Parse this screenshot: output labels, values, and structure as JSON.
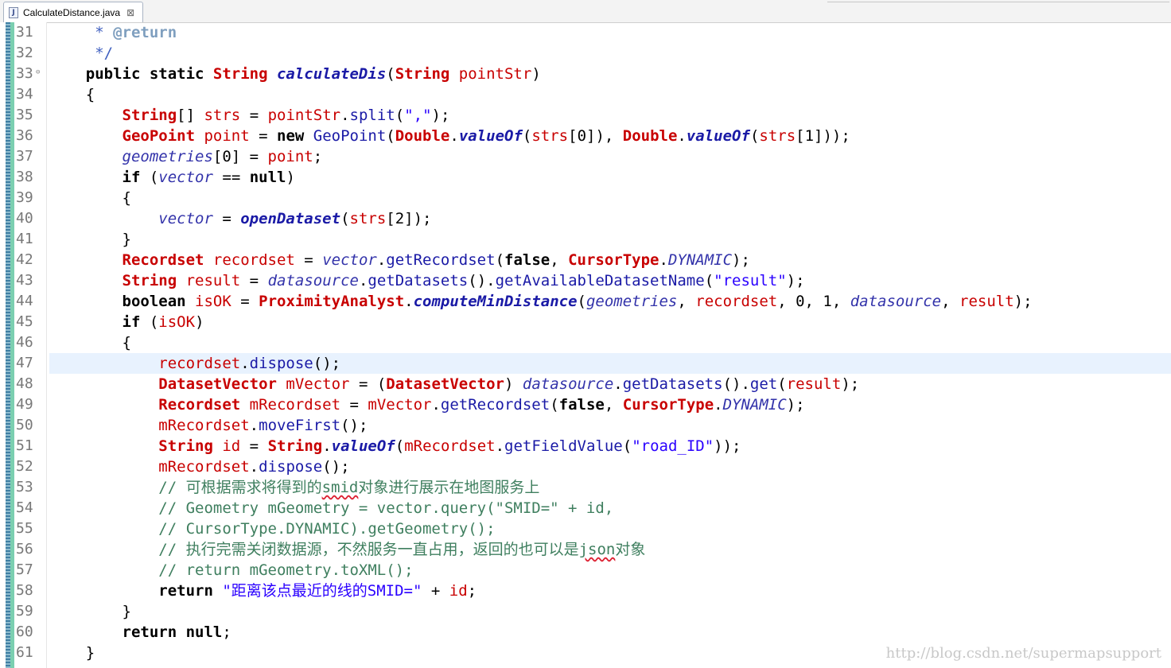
{
  "tab": {
    "title": "CalculateDistance.java",
    "icon": "java-file-icon",
    "close_glyph": "⊠"
  },
  "watermark": "http://blog.csdn.net/supermapsupport",
  "line_numbers": [
    "31",
    "32",
    "33",
    "34",
    "35",
    "36",
    "37",
    "38",
    "39",
    "40",
    "41",
    "42",
    "43",
    "44",
    "45",
    "46",
    "47",
    "48",
    "49",
    "50",
    "51",
    "52",
    "53",
    "54",
    "55",
    "56",
    "57",
    "58",
    "59",
    "60",
    "61"
  ],
  "highlighted_line": "47",
  "code": [
    [
      {
        "c": "cd",
        "t": "     * "
      },
      {
        "c": "tag",
        "t": "@return"
      }
    ],
    [
      {
        "c": "cd",
        "t": "     */"
      }
    ],
    [
      {
        "c": "k",
        "t": "    public static "
      },
      {
        "c": "t",
        "t": "String "
      },
      {
        "c": "sm",
        "t": "calculateDis"
      },
      {
        "c": "p",
        "t": "("
      },
      {
        "c": "t",
        "t": "String "
      },
      {
        "c": "v",
        "t": "pointStr"
      },
      {
        "c": "p",
        "t": ")"
      }
    ],
    [
      {
        "c": "p",
        "t": "    {"
      }
    ],
    [
      {
        "c": "t",
        "t": "        String"
      },
      {
        "c": "p",
        "t": "[] "
      },
      {
        "c": "v",
        "t": "strs"
      },
      {
        "c": "p",
        "t": " = "
      },
      {
        "c": "v",
        "t": "pointStr"
      },
      {
        "c": "p",
        "t": "."
      },
      {
        "c": "m",
        "t": "split"
      },
      {
        "c": "p",
        "t": "("
      },
      {
        "c": "s",
        "t": "\",\""
      },
      {
        "c": "p",
        "t": ");"
      }
    ],
    [
      {
        "c": "t",
        "t": "        GeoPoint "
      },
      {
        "c": "v",
        "t": "point"
      },
      {
        "c": "p",
        "t": " = "
      },
      {
        "c": "k",
        "t": "new "
      },
      {
        "c": "m",
        "t": "GeoPoint"
      },
      {
        "c": "p",
        "t": "("
      },
      {
        "c": "t",
        "t": "Double"
      },
      {
        "c": "p",
        "t": "."
      },
      {
        "c": "sm",
        "t": "valueOf"
      },
      {
        "c": "p",
        "t": "("
      },
      {
        "c": "v",
        "t": "strs"
      },
      {
        "c": "p",
        "t": "[0]), "
      },
      {
        "c": "t",
        "t": "Double"
      },
      {
        "c": "p",
        "t": "."
      },
      {
        "c": "sm",
        "t": "valueOf"
      },
      {
        "c": "p",
        "t": "("
      },
      {
        "c": "v",
        "t": "strs"
      },
      {
        "c": "p",
        "t": "[1]));"
      }
    ],
    [
      {
        "c": "e",
        "t": "        geometries"
      },
      {
        "c": "p",
        "t": "[0] = "
      },
      {
        "c": "v",
        "t": "point"
      },
      {
        "c": "p",
        "t": ";"
      }
    ],
    [
      {
        "c": "k",
        "t": "        if "
      },
      {
        "c": "p",
        "t": "("
      },
      {
        "c": "e",
        "t": "vector"
      },
      {
        "c": "p",
        "t": " == "
      },
      {
        "c": "k",
        "t": "null"
      },
      {
        "c": "p",
        "t": ")"
      }
    ],
    [
      {
        "c": "p",
        "t": "        {"
      }
    ],
    [
      {
        "c": "e",
        "t": "            vector"
      },
      {
        "c": "p",
        "t": " = "
      },
      {
        "c": "sm",
        "t": "openDataset"
      },
      {
        "c": "p",
        "t": "("
      },
      {
        "c": "v",
        "t": "strs"
      },
      {
        "c": "p",
        "t": "[2]);"
      }
    ],
    [
      {
        "c": "p",
        "t": "        }"
      }
    ],
    [
      {
        "c": "t",
        "t": "        Recordset "
      },
      {
        "c": "v",
        "t": "recordset"
      },
      {
        "c": "p",
        "t": " = "
      },
      {
        "c": "e",
        "t": "vector"
      },
      {
        "c": "p",
        "t": "."
      },
      {
        "c": "m",
        "t": "getRecordset"
      },
      {
        "c": "p",
        "t": "("
      },
      {
        "c": "k",
        "t": "false"
      },
      {
        "c": "p",
        "t": ", "
      },
      {
        "c": "t",
        "t": "CursorType"
      },
      {
        "c": "p",
        "t": "."
      },
      {
        "c": "e",
        "t": "DYNAMIC"
      },
      {
        "c": "p",
        "t": ");"
      }
    ],
    [
      {
        "c": "t",
        "t": "        String "
      },
      {
        "c": "v",
        "t": "result"
      },
      {
        "c": "p",
        "t": " = "
      },
      {
        "c": "e",
        "t": "datasource"
      },
      {
        "c": "p",
        "t": "."
      },
      {
        "c": "m",
        "t": "getDatasets"
      },
      {
        "c": "p",
        "t": "()."
      },
      {
        "c": "m",
        "t": "getAvailableDatasetName"
      },
      {
        "c": "p",
        "t": "("
      },
      {
        "c": "s",
        "t": "\"result\""
      },
      {
        "c": "p",
        "t": ");"
      }
    ],
    [
      {
        "c": "k",
        "t": "        boolean "
      },
      {
        "c": "v",
        "t": "isOK"
      },
      {
        "c": "p",
        "t": " = "
      },
      {
        "c": "t",
        "t": "ProximityAnalyst"
      },
      {
        "c": "p",
        "t": "."
      },
      {
        "c": "sm",
        "t": "computeMinDistance"
      },
      {
        "c": "p",
        "t": "("
      },
      {
        "c": "e",
        "t": "geometries"
      },
      {
        "c": "p",
        "t": ", "
      },
      {
        "c": "v",
        "t": "recordset"
      },
      {
        "c": "p",
        "t": ", 0, 1, "
      },
      {
        "c": "e",
        "t": "datasource"
      },
      {
        "c": "p",
        "t": ", "
      },
      {
        "c": "v",
        "t": "result"
      },
      {
        "c": "p",
        "t": ");"
      }
    ],
    [
      {
        "c": "k",
        "t": "        if "
      },
      {
        "c": "p",
        "t": "("
      },
      {
        "c": "v",
        "t": "isOK"
      },
      {
        "c": "p",
        "t": ")"
      }
    ],
    [
      {
        "c": "p",
        "t": "        {"
      }
    ],
    [
      {
        "c": "v",
        "t": "            recordset"
      },
      {
        "c": "p",
        "t": "."
      },
      {
        "c": "m",
        "t": "dispose"
      },
      {
        "c": "p",
        "t": "();"
      }
    ],
    [
      {
        "c": "t",
        "t": "            DatasetVector "
      },
      {
        "c": "v",
        "t": "mVector"
      },
      {
        "c": "p",
        "t": " = ("
      },
      {
        "c": "t",
        "t": "DatasetVector"
      },
      {
        "c": "p",
        "t": ") "
      },
      {
        "c": "e",
        "t": "datasource"
      },
      {
        "c": "p",
        "t": "."
      },
      {
        "c": "m",
        "t": "getDatasets"
      },
      {
        "c": "p",
        "t": "()."
      },
      {
        "c": "m",
        "t": "get"
      },
      {
        "c": "p",
        "t": "("
      },
      {
        "c": "v",
        "t": "result"
      },
      {
        "c": "p",
        "t": ");"
      }
    ],
    [
      {
        "c": "t",
        "t": "            Recordset "
      },
      {
        "c": "v",
        "t": "mRecordset"
      },
      {
        "c": "p",
        "t": " = "
      },
      {
        "c": "v",
        "t": "mVector"
      },
      {
        "c": "p",
        "t": "."
      },
      {
        "c": "m",
        "t": "getRecordset"
      },
      {
        "c": "p",
        "t": "("
      },
      {
        "c": "k",
        "t": "false"
      },
      {
        "c": "p",
        "t": ", "
      },
      {
        "c": "t",
        "t": "CursorType"
      },
      {
        "c": "p",
        "t": "."
      },
      {
        "c": "e",
        "t": "DYNAMIC"
      },
      {
        "c": "p",
        "t": ");"
      }
    ],
    [
      {
        "c": "v",
        "t": "            mRecordset"
      },
      {
        "c": "p",
        "t": "."
      },
      {
        "c": "m",
        "t": "moveFirst"
      },
      {
        "c": "p",
        "t": "();"
      }
    ],
    [
      {
        "c": "t",
        "t": "            String "
      },
      {
        "c": "v",
        "t": "id"
      },
      {
        "c": "p",
        "t": " = "
      },
      {
        "c": "t",
        "t": "String"
      },
      {
        "c": "p",
        "t": "."
      },
      {
        "c": "sm",
        "t": "valueOf"
      },
      {
        "c": "p",
        "t": "("
      },
      {
        "c": "v",
        "t": "mRecordset"
      },
      {
        "c": "p",
        "t": "."
      },
      {
        "c": "m",
        "t": "getFieldValue"
      },
      {
        "c": "p",
        "t": "("
      },
      {
        "c": "s",
        "t": "\"road_ID\""
      },
      {
        "c": "p",
        "t": "));"
      }
    ],
    [
      {
        "c": "v",
        "t": "            mRecordset"
      },
      {
        "c": "p",
        "t": "."
      },
      {
        "c": "m",
        "t": "dispose"
      },
      {
        "c": "p",
        "t": "();"
      }
    ],
    [
      {
        "c": "c",
        "t": "            // 可根据需求将得到的"
      },
      {
        "c": "c squig",
        "t": "smid"
      },
      {
        "c": "c",
        "t": "对象进行展示在地图服务上"
      }
    ],
    [
      {
        "c": "c",
        "t": "            // Geometry mGeometry = vector.query(\"SMID=\" + id,"
      }
    ],
    [
      {
        "c": "c",
        "t": "            // CursorType.DYNAMIC).getGeometry();"
      }
    ],
    [
      {
        "c": "c",
        "t": "            // 执行完需关闭数据源，不然服务一直占用，返回的也可以是"
      },
      {
        "c": "c squig",
        "t": "json"
      },
      {
        "c": "c",
        "t": "对象"
      }
    ],
    [
      {
        "c": "c",
        "t": "            // return mGeometry.toXML();"
      }
    ],
    [
      {
        "c": "k",
        "t": "            return "
      },
      {
        "c": "s",
        "t": "\"距离该点最近的线的SMID=\""
      },
      {
        "c": "p",
        "t": " + "
      },
      {
        "c": "v",
        "t": "id"
      },
      {
        "c": "p",
        "t": ";"
      }
    ],
    [
      {
        "c": "p",
        "t": "        }"
      }
    ],
    [
      {
        "c": "k",
        "t": "        return null"
      },
      {
        "c": "p",
        "t": ";"
      }
    ],
    [
      {
        "c": "p",
        "t": "    }"
      }
    ]
  ]
}
